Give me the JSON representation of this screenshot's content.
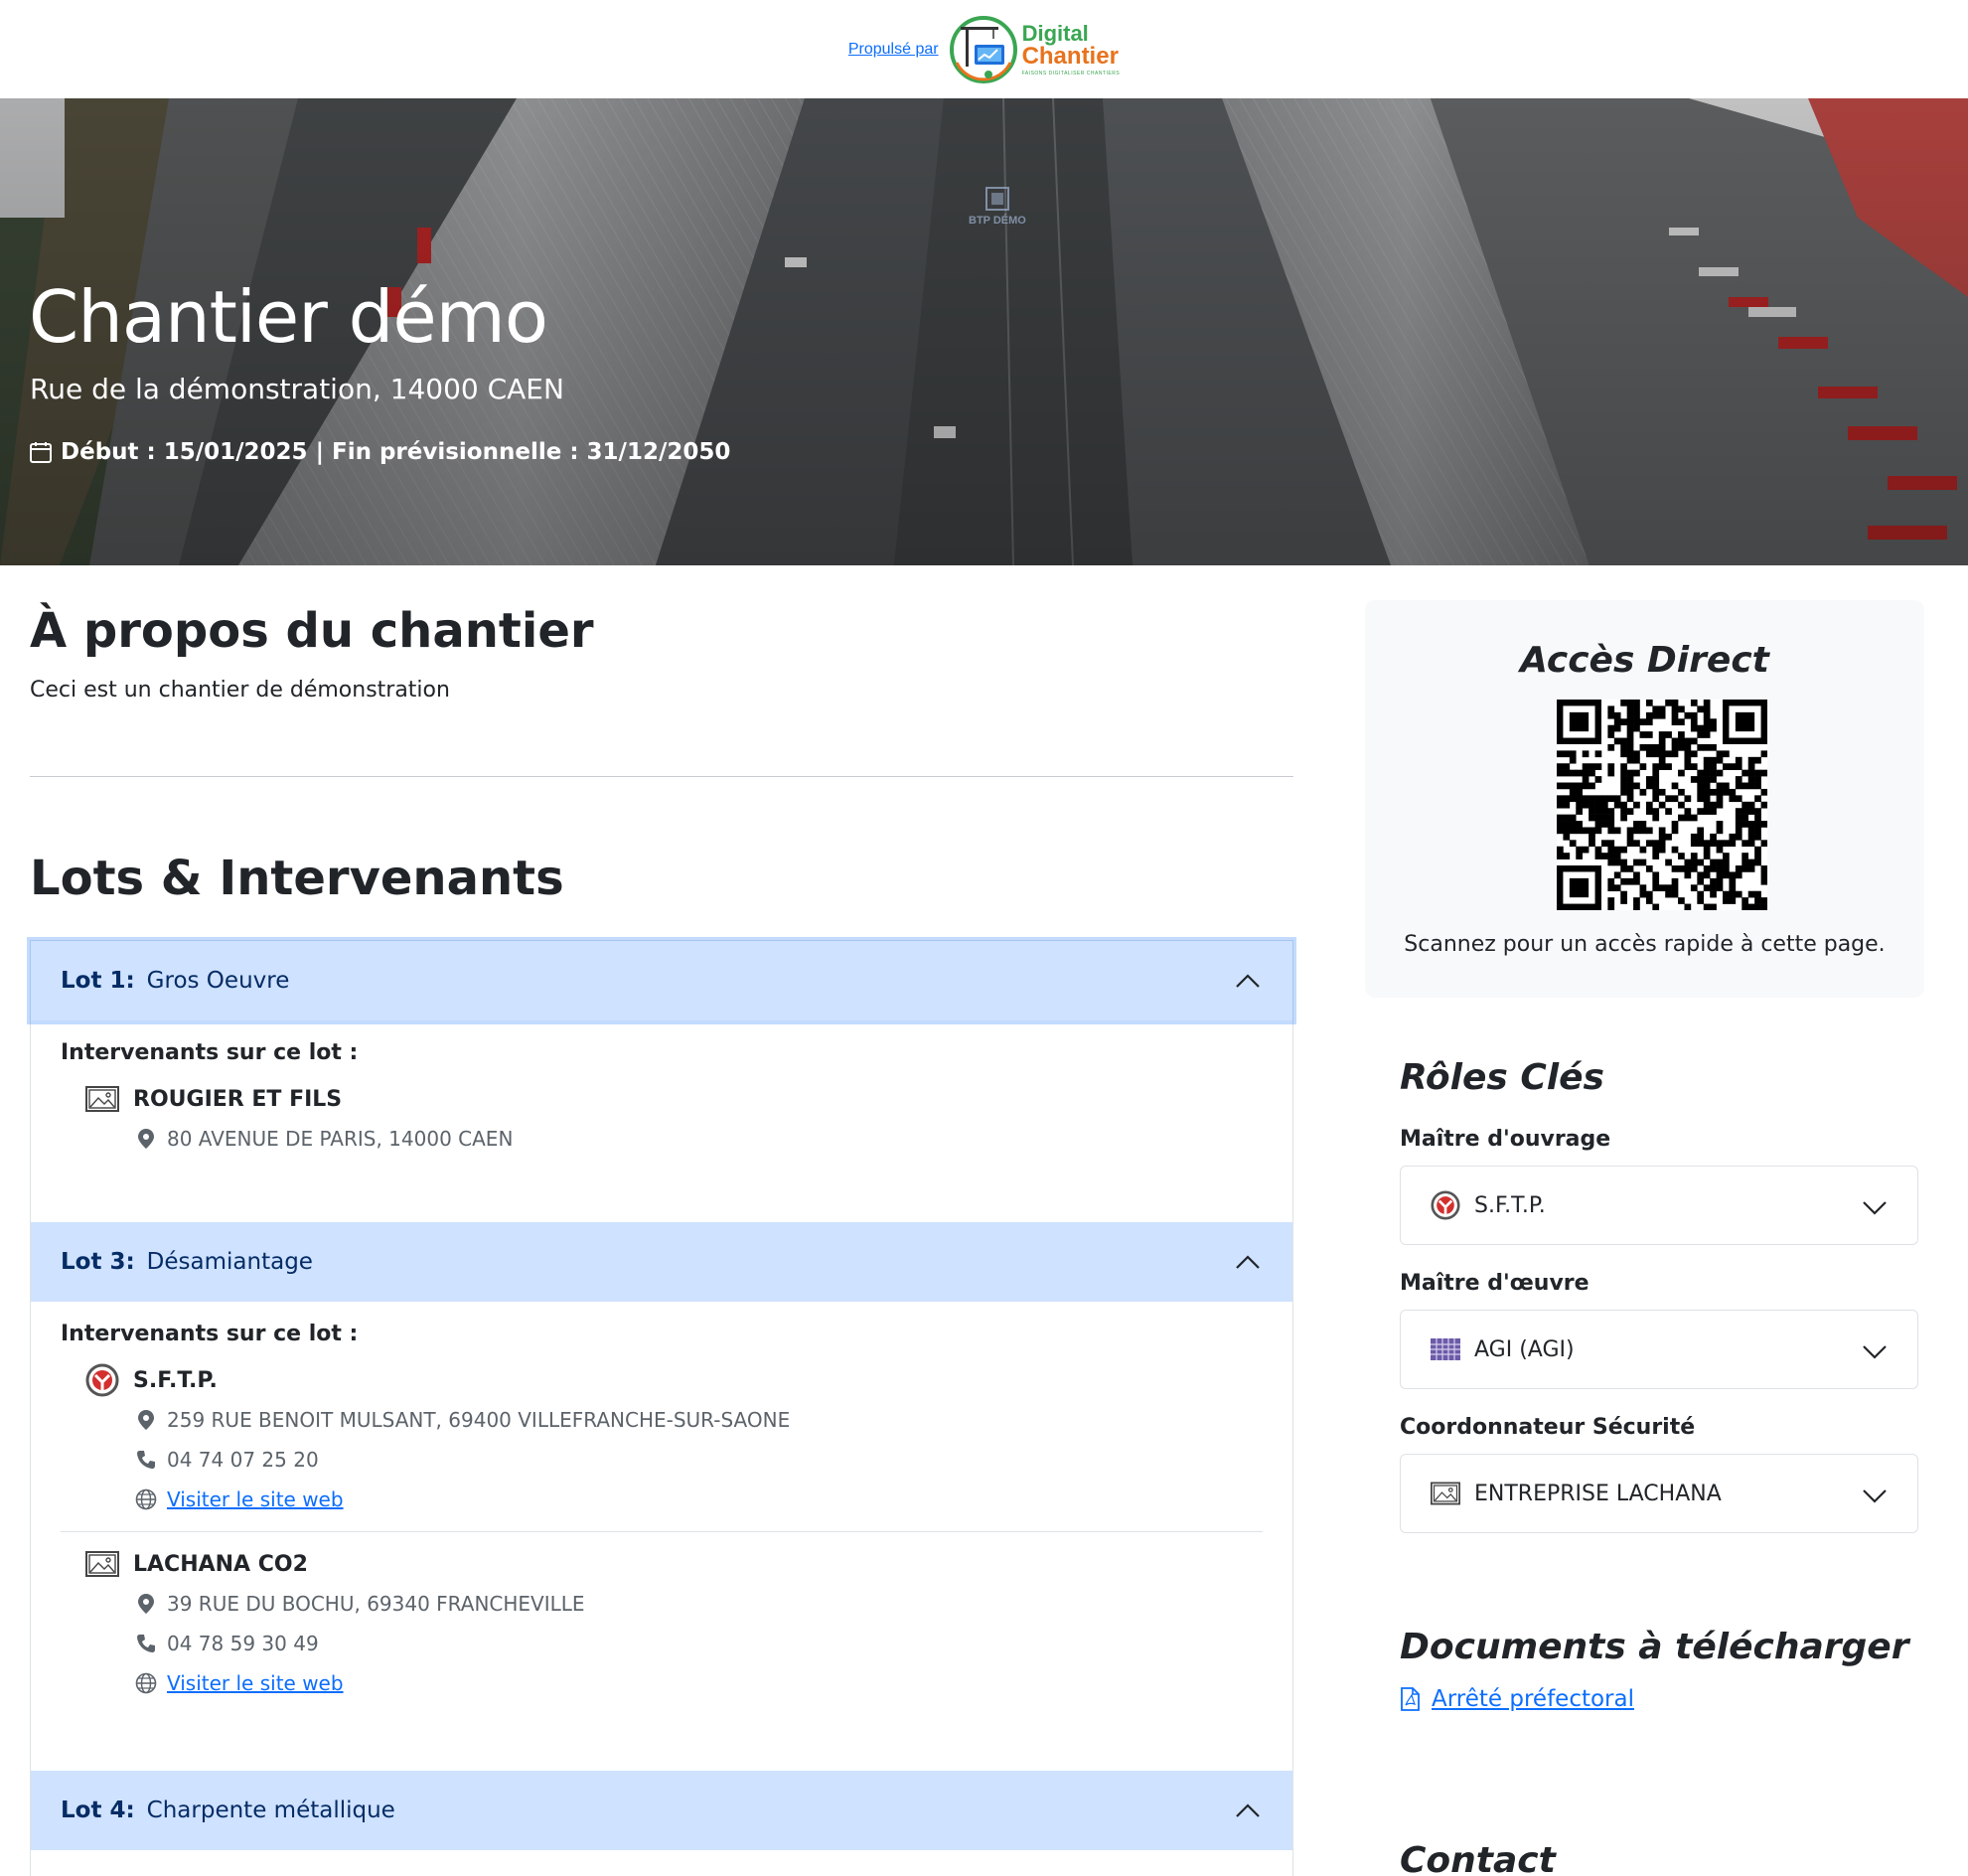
{
  "header": {
    "powered_by": "Propulsé par",
    "logo_line1": "Digital",
    "logo_line2": "Chantier",
    "logo_tagline": "FAISONS DIGITALISER CHANTIERS"
  },
  "hero": {
    "title": "Chantier démo",
    "address": "Rue de la démonstration, 14000 CAEN",
    "dates": "Début : 15/01/2025 | Fin prévisionnelle : 31/12/2050",
    "watermark": "BTP DÉMO"
  },
  "about": {
    "title": "À propos du chantier",
    "description": "Ceci est un chantier de démonstration"
  },
  "lots": {
    "title": "Lots & Intervenants",
    "intervenants_label": "Intervenants sur ce lot :",
    "items": [
      {
        "number": "Lot 1:",
        "name": "Gros Oeuvre",
        "companies": [
          {
            "name": "ROUGIER ET FILS",
            "address": "80 AVENUE DE PARIS, 14000 CAEN",
            "logo": "image-placeholder-icon"
          }
        ]
      },
      {
        "number": "Lot 3:",
        "name": "Désamiantage",
        "companies": [
          {
            "name": "S.F.T.P.",
            "address": "259 RUE BENOIT MULSANT, 69400 VILLEFRANCHE-SUR-SAONE",
            "phone": "04 74 07 25 20",
            "website": "Visiter le site web",
            "logo": "sftp-logo-icon"
          },
          {
            "name": "LACHANA CO2",
            "address": "39 RUE DU BOCHU, 69340 FRANCHEVILLE",
            "phone": "04 78 59 30 49",
            "website": "Visiter le site web",
            "logo": "image-placeholder-icon"
          }
        ]
      },
      {
        "number": "Lot 4:",
        "name": "Charpente métallique",
        "companies": []
      }
    ]
  },
  "direct_access": {
    "title": "Accès Direct",
    "caption": "Scannez pour un accès rapide à cette page."
  },
  "roles": {
    "title": "Rôles Clés",
    "items": [
      {
        "label": "Maître d'ouvrage",
        "value": "S.F.T.P.",
        "icon": "sftp-logo-icon"
      },
      {
        "label": "Maître d'œuvre",
        "value": "AGI (AGI)",
        "icon": "agi-logo-icon"
      },
      {
        "label": "Coordonnateur Sécurité",
        "value": "ENTREPRISE LACHANA",
        "icon": "image-placeholder-icon"
      }
    ]
  },
  "documents": {
    "title": "Documents à télécharger",
    "items": [
      {
        "label": "Arrêté préfectoral",
        "icon": "pdf-file-icon"
      }
    ]
  },
  "contact": {
    "title": "Contact"
  },
  "colors": {
    "accordion_header_bg": "#cfe2ff",
    "accordion_header_text": "#052c65",
    "link": "#0d6efd",
    "card_bg": "#f8f9fa",
    "logo_green": "#3aa652",
    "logo_orange": "#e8731d"
  }
}
